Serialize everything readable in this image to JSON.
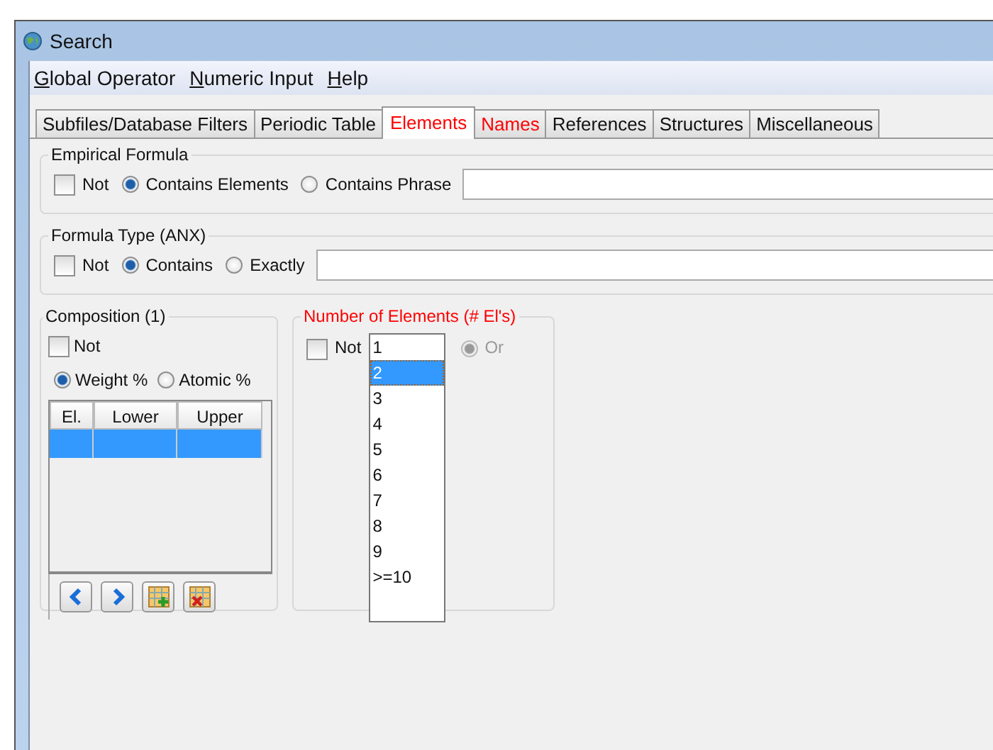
{
  "window": {
    "title": "Search"
  },
  "menu": [
    {
      "label": "Global Operator"
    },
    {
      "label": "Numeric Input"
    },
    {
      "label": "Help"
    }
  ],
  "tabs": [
    {
      "label": "Subfiles/Database Filters",
      "selected": false,
      "flagged": false
    },
    {
      "label": "Periodic Table",
      "selected": false,
      "flagged": false
    },
    {
      "label": "Elements",
      "selected": true,
      "flagged": true
    },
    {
      "label": "Names",
      "selected": false,
      "flagged": true
    },
    {
      "label": "References",
      "selected": false,
      "flagged": false
    },
    {
      "label": "Structures",
      "selected": false,
      "flagged": false
    },
    {
      "label": "Miscellaneous",
      "selected": false,
      "flagged": false
    }
  ],
  "empirical_formula": {
    "title": "Empirical Formula",
    "not": {
      "label": "Not",
      "checked": false
    },
    "options": [
      {
        "label": "Contains Elements",
        "selected": true
      },
      {
        "label": "Contains Phrase",
        "selected": false
      }
    ]
  },
  "formula_type": {
    "title": "Formula Type (ANX)",
    "not": {
      "label": "Not",
      "checked": false
    },
    "options": [
      {
        "label": "Contains",
        "selected": true
      },
      {
        "label": "Exactly",
        "selected": false
      }
    ]
  },
  "composition": {
    "title": "Composition (1)",
    "not": {
      "label": "Not",
      "checked": false
    },
    "options": [
      {
        "label": "Weight %",
        "selected": true
      },
      {
        "label": "Atomic %",
        "selected": false
      }
    ],
    "columns": [
      "El.",
      "Lower",
      "Upper"
    ],
    "rows": [
      {
        "selected": true
      }
    ]
  },
  "number_of_elements": {
    "title": "Number of Elements (# El's)",
    "flagged": true,
    "not": {
      "label": "Not",
      "checked": false
    },
    "items": [
      {
        "label": "1",
        "selected": false
      },
      {
        "label": "2",
        "selected": true
      },
      {
        "label": "3",
        "selected": false
      },
      {
        "label": "4",
        "selected": false
      },
      {
        "label": "5",
        "selected": false
      },
      {
        "label": "6",
        "selected": false
      },
      {
        "label": "7",
        "selected": false
      },
      {
        "label": "8",
        "selected": false
      },
      {
        "label": "9",
        "selected": false
      },
      {
        "label": ">=10",
        "selected": false
      }
    ],
    "or": {
      "label": "Or",
      "selected": true,
      "disabled": true
    }
  }
}
